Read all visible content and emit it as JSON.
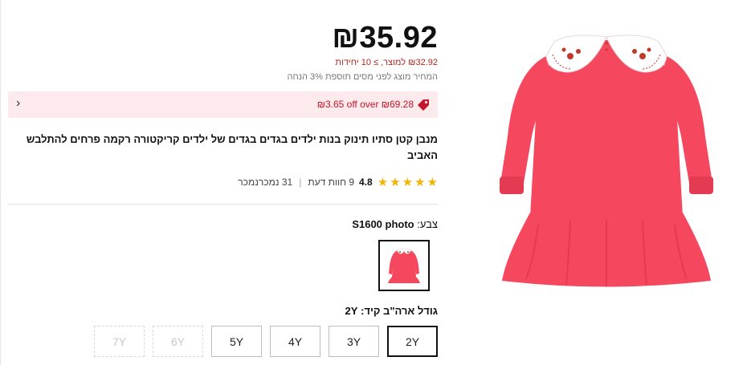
{
  "price": "₪35.92",
  "unit_price_text": "₪32.92 למוצר, ≥ 10 יחידות",
  "tax_note": "המחיר מוצג לפני מסים תוספת 3% הנחה",
  "promo": {
    "text": "₪3.65 off over ₪69.28",
    "icon": "tag-icon",
    "chevron": "‹"
  },
  "title": "מנבן קטן סתיו תינוק בנות ילדים בגדים בגדים של ילדים קריקטורה רקמה פרחים להתלבש האביב",
  "rating": {
    "score": "4.8",
    "stars": [
      "★",
      "★",
      "★",
      "★",
      "★"
    ],
    "reviews": "9 חוות דעת",
    "separator": "|",
    "sold": "31 נמכרנמכר"
  },
  "color": {
    "label": "צבע: ",
    "value": "S1600 photo"
  },
  "size": {
    "label": "גודל ארה\"ב קיד: 2Y",
    "options": [
      {
        "label": "2Y",
        "state": "selected"
      },
      {
        "label": "3Y",
        "state": "available"
      },
      {
        "label": "4Y",
        "state": "available"
      },
      {
        "label": "5Y",
        "state": "available"
      },
      {
        "label": "6Y",
        "state": "disabled"
      },
      {
        "label": "7Y",
        "state": "disabled"
      }
    ]
  },
  "colors": {
    "dress": "#f5485f",
    "dress_shadow": "#d8324a",
    "collar": "#ffffff",
    "embroidery": "#c0392b",
    "accent_red": "#c5162a",
    "promo_bg": "#fdeaec",
    "star": "#f6b400"
  }
}
